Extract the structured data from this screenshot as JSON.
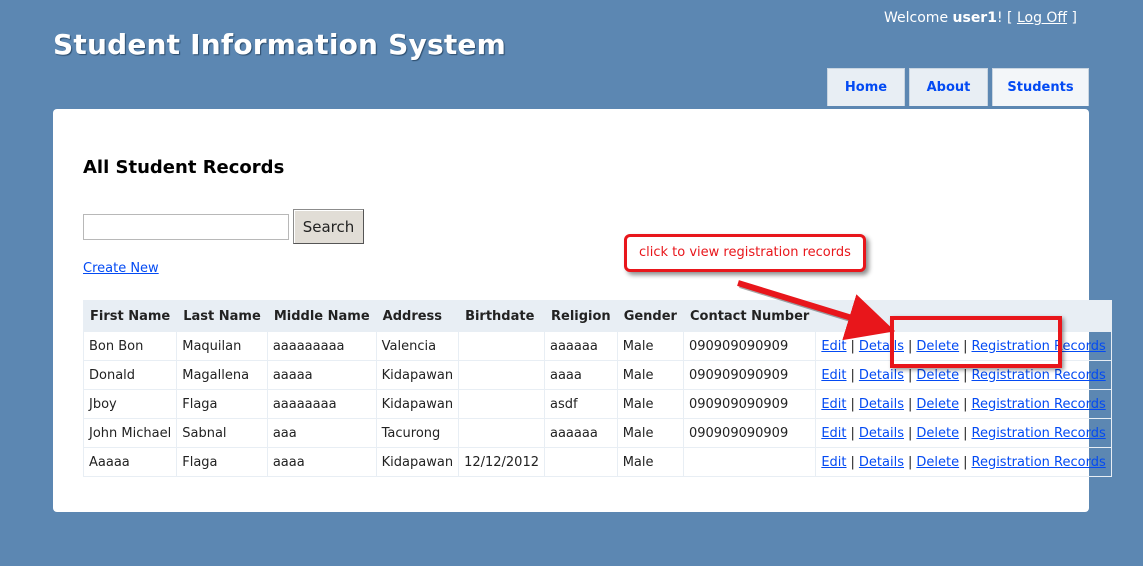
{
  "header": {
    "title": "Student Information System",
    "welcome_prefix": "Welcome ",
    "username": "user1",
    "welcome_suffix": "! [ ",
    "logoff_label": "Log Off",
    "login_close": " ]"
  },
  "menu": {
    "home": "Home",
    "about": "About",
    "students": "Students"
  },
  "page": {
    "heading": "All Student Records",
    "search_value": "",
    "search_button": "Search",
    "create_new": "Create New"
  },
  "table": {
    "columns": [
      "First Name",
      "Last Name",
      "Middle Name",
      "Address",
      "Birthdate",
      "Religion",
      "Gender",
      "Contact Number"
    ],
    "rows": [
      [
        "Bon Bon",
        "Maquilan",
        "aaaaaaaaa",
        "Valencia",
        "",
        "aaaaaa",
        "Male",
        "090909090909"
      ],
      [
        "Donald",
        "Magallena",
        "aaaaa",
        "Kidapawan",
        "",
        "aaaa",
        "Male",
        "090909090909"
      ],
      [
        "Jboy",
        "Flaga",
        "aaaaaaaa",
        "Kidapawan",
        "",
        "asdf",
        "Male",
        "090909090909"
      ],
      [
        "John Michael",
        "Sabnal",
        "aaa",
        "Tacurong",
        "",
        "aaaaaa",
        "Male",
        "090909090909"
      ],
      [
        "Aaaaa",
        "Flaga",
        "aaaa",
        "Kidapawan",
        "12/12/2012",
        "",
        "Male",
        ""
      ]
    ],
    "actions": {
      "edit": "Edit",
      "details": "Details",
      "delete": "Delete",
      "registration": "Registration Records",
      "separator": "|"
    }
  },
  "annotation": {
    "callout_text": "click to view registration records",
    "color": "#e8161b"
  },
  "colors": {
    "background": "#5c87b2",
    "link": "#034af3",
    "header_row": "#e8eef4"
  }
}
